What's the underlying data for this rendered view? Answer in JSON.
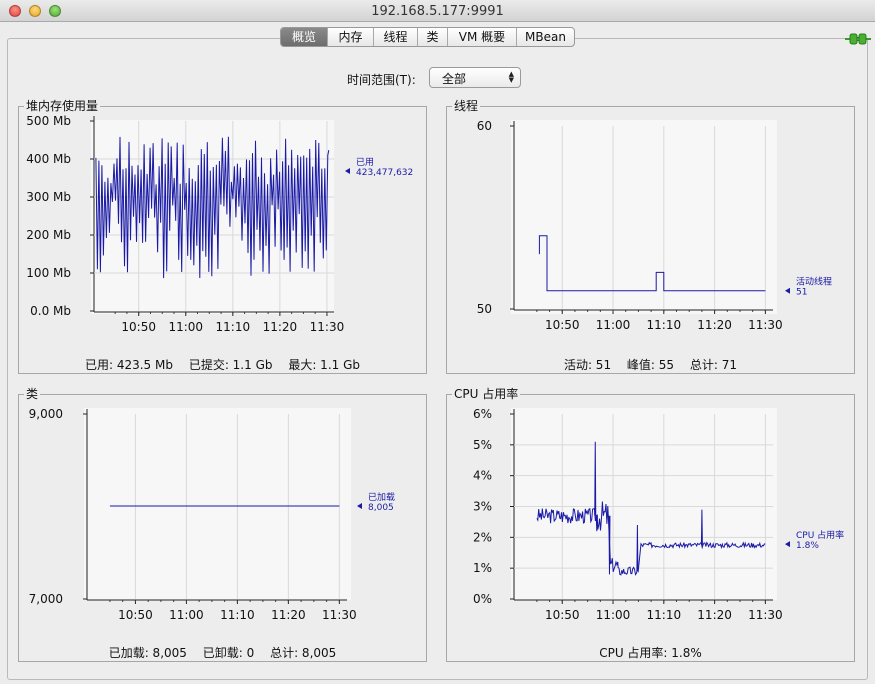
{
  "window": {
    "title": "192.168.5.177:9991"
  },
  "tabs": [
    {
      "label": "概览",
      "selected": true
    },
    {
      "label": "内存",
      "selected": false
    },
    {
      "label": "线程",
      "selected": false
    },
    {
      "label": "类",
      "selected": false
    },
    {
      "label": "VM 概要",
      "selected": false
    },
    {
      "label": "MBean",
      "selected": false
    }
  ],
  "time_range": {
    "label": "时间范围(T):",
    "value": "全部"
  },
  "colors": {
    "series": "#1a1aa6",
    "grid": "#d9d9d9",
    "plot_bg": "#f7f7f7",
    "connection": "#3a9a2a"
  },
  "panels": {
    "heap": {
      "title": "堆内存使用量",
      "summary": {
        "used": "已用: 423.5 Mb",
        "committed": "已提交: 1.1 Gb",
        "max": "最大: 1.1 Gb"
      }
    },
    "threads": {
      "title": "线程",
      "summary": {
        "live": "活动: 51",
        "peak": "峰值: 55",
        "total": "总计: 71"
      }
    },
    "classes": {
      "title": "类",
      "summary": {
        "loaded": "已加载: 8,005",
        "unloaded": "已卸载: 0",
        "total": "总计: 8,005"
      }
    },
    "cpu": {
      "title": "CPU 占用率",
      "summary": {
        "usage": "CPU 占用率: 1.8%"
      }
    }
  },
  "chart_data": [
    {
      "id": "heap",
      "type": "line",
      "title": "堆内存使用量",
      "x_ticks": [
        "10:50",
        "11:00",
        "11:10",
        "11:20",
        "11:30"
      ],
      "y_ticks": [
        "0.0 Mb",
        "100 Mb",
        "200 Mb",
        "300 Mb",
        "400 Mb",
        "500 Mb"
      ],
      "ylim": [
        0,
        500
      ],
      "unit": "Mb",
      "x_range_min": [
        10.9,
        30.5
      ],
      "series": [
        {
          "name": "已用",
          "value_label": "423,477,632",
          "pattern": "sawtooth",
          "low_range": [
            85,
            300
          ],
          "high_range": [
            330,
            460
          ],
          "last": 423.5
        }
      ]
    },
    {
      "id": "threads",
      "type": "line",
      "title": "线程",
      "x_ticks": [
        "10:50",
        "11:00",
        "11:10",
        "11:20",
        "11:30"
      ],
      "y_ticks": [
        "50",
        "60"
      ],
      "ylim": [
        50,
        60
      ],
      "series": [
        {
          "name": "活动线程",
          "value_label": "51",
          "points": [
            [
              45.5,
              53
            ],
            [
              45.5,
              54
            ],
            [
              47.0,
              54
            ],
            [
              47.0,
              51
            ],
            [
              68.5,
              51
            ],
            [
              68.5,
              52
            ],
            [
              70.0,
              52
            ],
            [
              70.0,
              51
            ],
            [
              90.0,
              51
            ]
          ]
        }
      ]
    },
    {
      "id": "classes",
      "type": "line",
      "title": "类",
      "x_ticks": [
        "10:50",
        "11:00",
        "11:10",
        "11:20",
        "11:30"
      ],
      "y_ticks": [
        "7,000",
        "9,000"
      ],
      "ylim": [
        7000,
        9000
      ],
      "series": [
        {
          "name": "已加载",
          "value_label": "8,005",
          "points": [
            [
              45.0,
              8005
            ],
            [
              90.0,
              8005
            ]
          ]
        }
      ]
    },
    {
      "id": "cpu",
      "type": "line",
      "title": "CPU 占用率",
      "x_ticks": [
        "10:50",
        "11:00",
        "11:10",
        "11:20",
        "11:30"
      ],
      "y_ticks": [
        "0%",
        "1%",
        "2%",
        "3%",
        "4%",
        "5%",
        "6%"
      ],
      "ylim": [
        0,
        6
      ],
      "series": [
        {
          "name": "CPU 占用率",
          "value_label": "1.8%",
          "segments": [
            {
              "from": 45.0,
              "to": 57.0,
              "level": 2.7,
              "noise": 0.25
            },
            {
              "from": 57.0,
              "to": 59.0,
              "level": 2.7,
              "noise": 0.5
            },
            {
              "from": 59.5,
              "to": 61.0,
              "level": 1.1,
              "noise": 0.25
            },
            {
              "from": 61.0,
              "to": 65.0,
              "level": 0.9,
              "noise": 0.15
            },
            {
              "from": 65.5,
              "to": 90.0,
              "level": 1.75,
              "noise": 0.08
            }
          ],
          "spikes": [
            [
              56.5,
              5.1
            ],
            [
              56.8,
              2.2
            ],
            [
              64.8,
              2.4
            ],
            [
              77.5,
              2.9
            ],
            [
              59.3,
              0.8
            ]
          ]
        }
      ]
    }
  ]
}
